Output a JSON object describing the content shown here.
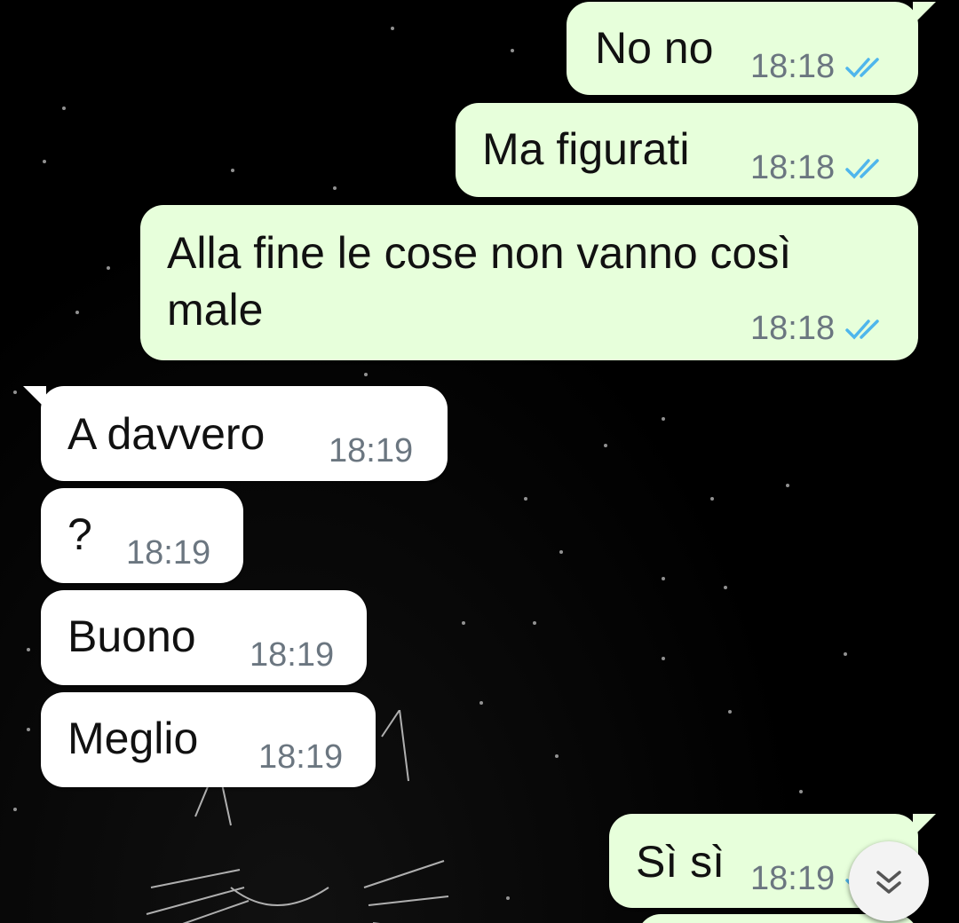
{
  "messages": [
    {
      "id": "m1",
      "direction": "outgoing",
      "text": "No no",
      "time": "18:18",
      "status": "read"
    },
    {
      "id": "m2",
      "direction": "outgoing",
      "text": "Ma figurati",
      "time": "18:18",
      "status": "read"
    },
    {
      "id": "m3",
      "direction": "outgoing",
      "text": "Alla fine le cose non vanno così\nmale",
      "time": "18:18",
      "status": "read"
    },
    {
      "id": "m4",
      "direction": "incoming",
      "text": "A davvero",
      "time": "18:19"
    },
    {
      "id": "m5",
      "direction": "incoming",
      "text": "?",
      "time": "18:19"
    },
    {
      "id": "m6",
      "direction": "incoming",
      "text": "Buono",
      "time": "18:19"
    },
    {
      "id": "m7",
      "direction": "incoming",
      "text": "Meglio",
      "time": "18:19"
    },
    {
      "id": "m8",
      "direction": "outgoing",
      "text": "Sì sì",
      "time": "18:19",
      "status": "read"
    }
  ],
  "scroll_button": {
    "icon": "double-chevron-down-icon"
  },
  "colors": {
    "outgoing_bubble": "#e7ffdb",
    "incoming_bubble": "#ffffff",
    "read_ticks": "#4fb6ec",
    "timestamp": "#6b7680",
    "background": "#000000"
  }
}
